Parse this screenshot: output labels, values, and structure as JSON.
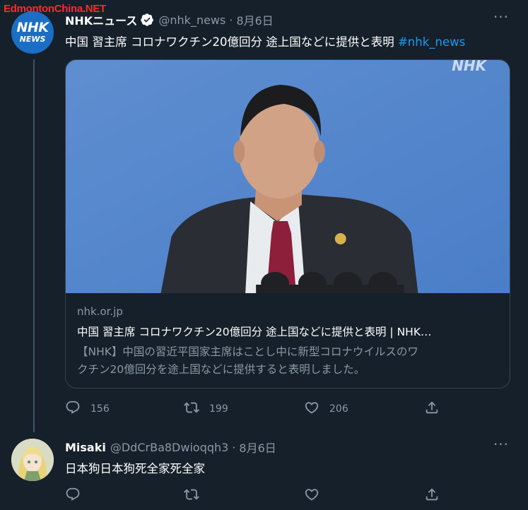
{
  "watermark": "EdmontonChina.NET",
  "tweets": [
    {
      "avatar": {
        "line1": "NHK",
        "line2": "NEWS"
      },
      "name": "NHKニュース",
      "handle": "@nhk_news",
      "separator": "·",
      "date": "8月6日",
      "text": "中国 習主席 コロナワクチン20億回分 途上国などに提供と表明",
      "hashtag": "#nhk_news",
      "more": "···",
      "card": {
        "image_logo": "NHK",
        "domain": "nhk.or.jp",
        "title": "中国 習主席 コロナワクチン20億回分 途上国などに提供と表明 | NHK…",
        "description_line1": "【NHK】中国の習近平国家主席はことし中に新型コロナウイルスのワ",
        "description_line2": "クチン20億回分を途上国などに提供すると表明しました。"
      },
      "replies": "156",
      "retweets": "199",
      "likes": "206"
    },
    {
      "name": "Misaki",
      "handle": "@DdCrBa8Dwioqqh3",
      "separator": "·",
      "date": "8月6日",
      "text": "日本狗日本狗死全家死全家",
      "more": "···",
      "replies": "",
      "retweets": "",
      "likes": ""
    }
  ],
  "colors": {
    "background": "#15202b",
    "text": "#ffffff",
    "secondary": "#8b98a5",
    "link": "#1d9bf0",
    "border": "#38444d",
    "verified": "#ffffff"
  }
}
